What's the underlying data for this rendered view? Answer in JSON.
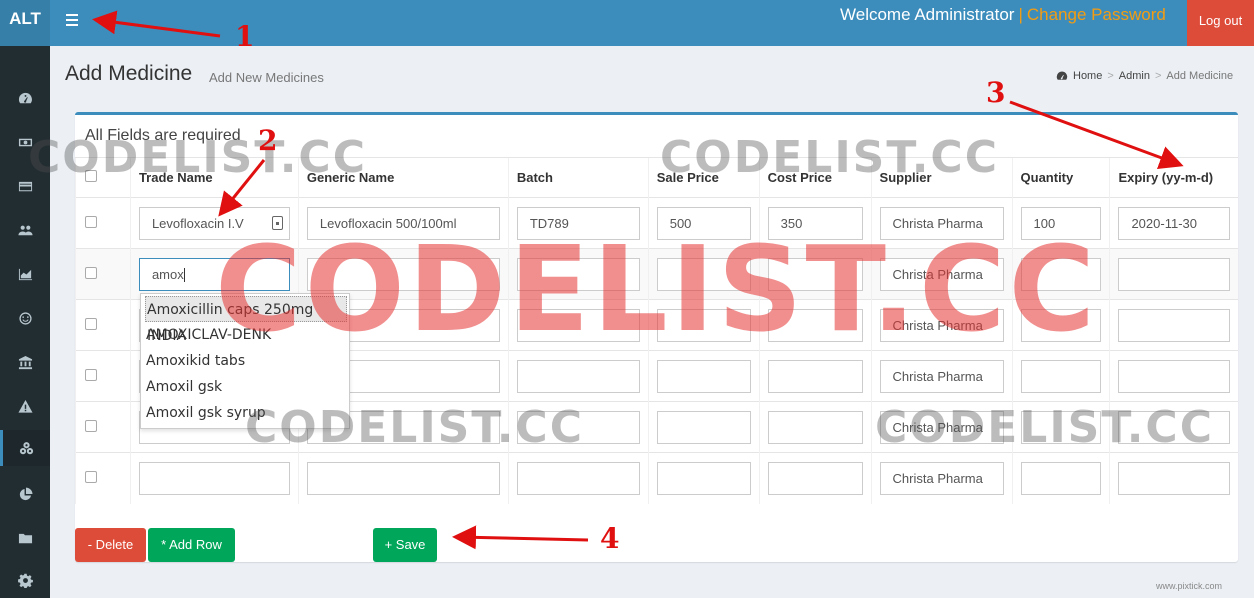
{
  "app": {
    "logo": "ALT"
  },
  "header": {
    "welcome": "Welcome Administrator",
    "separator": "|",
    "change_password": "Change Password",
    "logout": "Log out"
  },
  "sidebar": {
    "items": [
      {
        "icon": "dashboard-icon"
      },
      {
        "icon": "money-icon"
      },
      {
        "icon": "credit-card-icon"
      },
      {
        "icon": "users-icon"
      },
      {
        "icon": "area-chart-icon"
      },
      {
        "icon": "smile-icon"
      },
      {
        "icon": "bank-icon"
      },
      {
        "icon": "warning-icon"
      },
      {
        "icon": "medicine-icon",
        "active": true
      },
      {
        "icon": "pie-chart-icon"
      },
      {
        "icon": "folder-icon"
      },
      {
        "icon": "gear-icon"
      }
    ]
  },
  "page": {
    "title": "Add Medicine",
    "subtitle": "Add New Medicines",
    "breadcrumb": [
      "Home",
      "Admin",
      "Add Medicine"
    ],
    "breadcrumb_sep": ">"
  },
  "form": {
    "box_title": "All Fields are required",
    "columns": [
      "Trade Name",
      "Generic Name",
      "Batch",
      "Sale Price",
      "Cost Price",
      "Supplier",
      "Quantity",
      "Expiry (yy-m-d)"
    ],
    "rows": [
      [
        "Levofloxacin I.V",
        "Levofloxacin 500/100ml",
        "TD789",
        "500",
        "350",
        "Christa Pharma",
        "100",
        "2020-11-30"
      ],
      [
        "amox",
        "",
        "",
        "",
        "",
        "Christa Pharma",
        "",
        ""
      ],
      [
        "",
        "",
        "",
        "",
        "",
        "Christa Pharma",
        "",
        ""
      ],
      [
        "",
        "",
        "",
        "",
        "",
        "Christa Pharma",
        "",
        ""
      ],
      [
        "",
        "",
        "",
        "",
        "",
        "Christa Pharma",
        "",
        ""
      ],
      [
        "",
        "",
        "",
        "",
        "",
        "Christa Pharma",
        "",
        ""
      ]
    ],
    "autocomplete": [
      "Amoxicillin caps 250mg INDIA",
      "AMOXICLAV-DENK",
      "Amoxikid tabs",
      "Amoxil gsk",
      "Amoxil gsk syrup"
    ],
    "buttons": {
      "delete": "- Delete",
      "add_row": "* Add Row",
      "save": "+ Save"
    }
  },
  "annotations": [
    "1",
    "2",
    "3",
    "4"
  ],
  "watermark": {
    "text": "CODELIST.CC"
  },
  "credit": "www.pixtick.com",
  "colors": {
    "primary": "#3c8dbc",
    "danger": "#dd4b39",
    "success": "#00a65a",
    "accent": "#f39c12",
    "sidebar": "#222d32"
  }
}
